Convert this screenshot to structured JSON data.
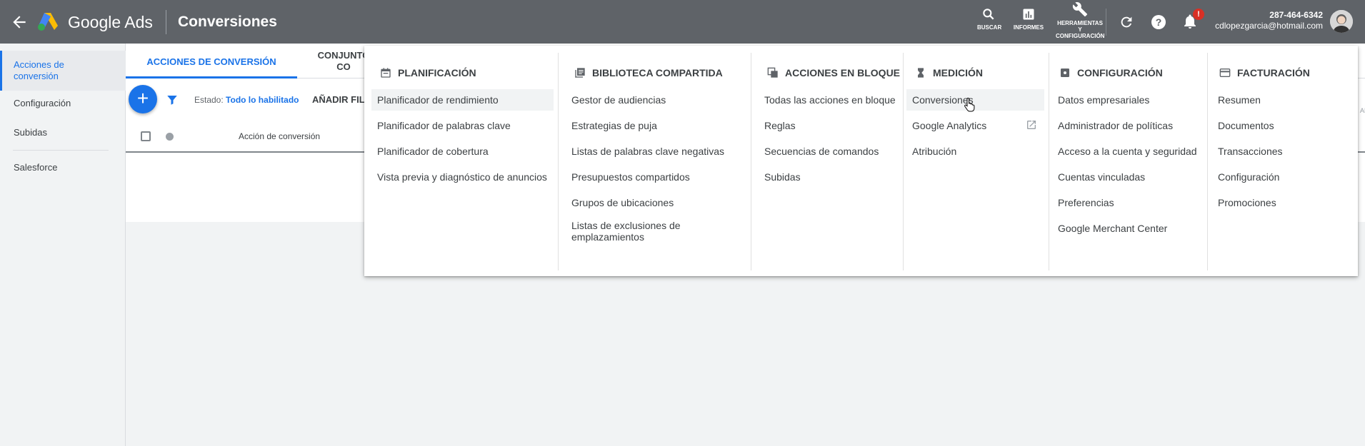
{
  "header": {
    "brand": "Google Ads",
    "page_title": "Conversiones",
    "tools": [
      {
        "label": "BUSCAR",
        "icon": "search-icon"
      },
      {
        "label": "INFORMES",
        "icon": "reports-icon"
      },
      {
        "label_lines": [
          "HERRAMIENTAS",
          "Y",
          "CONFIGURACIÓN"
        ],
        "icon": "wrench-icon"
      }
    ],
    "notification_badge": "!",
    "account_phone": "287-464-6342",
    "account_email": "cdlopezgarcia@hotmail.com"
  },
  "sidebar": {
    "items": [
      {
        "label": "Acciones de conversión",
        "active": true
      },
      {
        "label": "Configuración"
      },
      {
        "label": "Subidas"
      },
      {
        "label": "Salesforce"
      }
    ]
  },
  "main": {
    "tabs": [
      {
        "label": "ACCIONES DE CONVERSIÓN",
        "active": true
      },
      {
        "label_lines": [
          "CONJUNTO",
          "CO"
        ]
      }
    ],
    "status_label": "Estado:",
    "status_value": "Todo lo habilitado",
    "add_filter": "AÑADIR FIL",
    "table_header": "Acción de conversión"
  },
  "menu": {
    "columns": [
      {
        "title": "PLANIFICACIÓN",
        "icon": "calendar-icon",
        "items": [
          "Planificador de rendimiento",
          "Planificador de palabras clave",
          "Planificador de cobertura",
          "Vista previa y diagnóstico de anuncios"
        ]
      },
      {
        "title": "BIBLIOTECA COMPARTIDA",
        "icon": "library-icon",
        "items": [
          "Gestor de audiencias",
          "Estrategias de puja",
          "Listas de palabras clave negativas",
          "Presupuestos compartidos",
          "Grupos de ubicaciones",
          "Listas de exclusiones de emplazamientos"
        ]
      },
      {
        "title": "ACCIONES EN BLOQUE",
        "icon": "copy-icon",
        "items": [
          "Todas las acciones en bloque",
          "Reglas",
          "Secuencias de comandos",
          "Subidas"
        ]
      },
      {
        "title": "MEDICIÓN",
        "icon": "hourglass-icon",
        "items": [
          "Conversiones",
          "Google Analytics",
          "Atribución"
        ]
      },
      {
        "title": "CONFIGURACIÓN",
        "icon": "settings-icon",
        "items": [
          "Datos empresariales",
          "Administrador de políticas",
          "Acceso a la cuenta y seguridad",
          "Cuentas vinculadas",
          "Preferencias",
          "Google Merchant Center"
        ]
      },
      {
        "title": "FACTURACIÓN",
        "icon": "card-icon",
        "items": [
          "Resumen",
          "Documentos",
          "Transacciones",
          "Configuración",
          "Promociones"
        ]
      }
    ]
  },
  "colors": {
    "topbar": "#5f6368",
    "accent": "#1a73e8",
    "badge": "#d93025"
  }
}
